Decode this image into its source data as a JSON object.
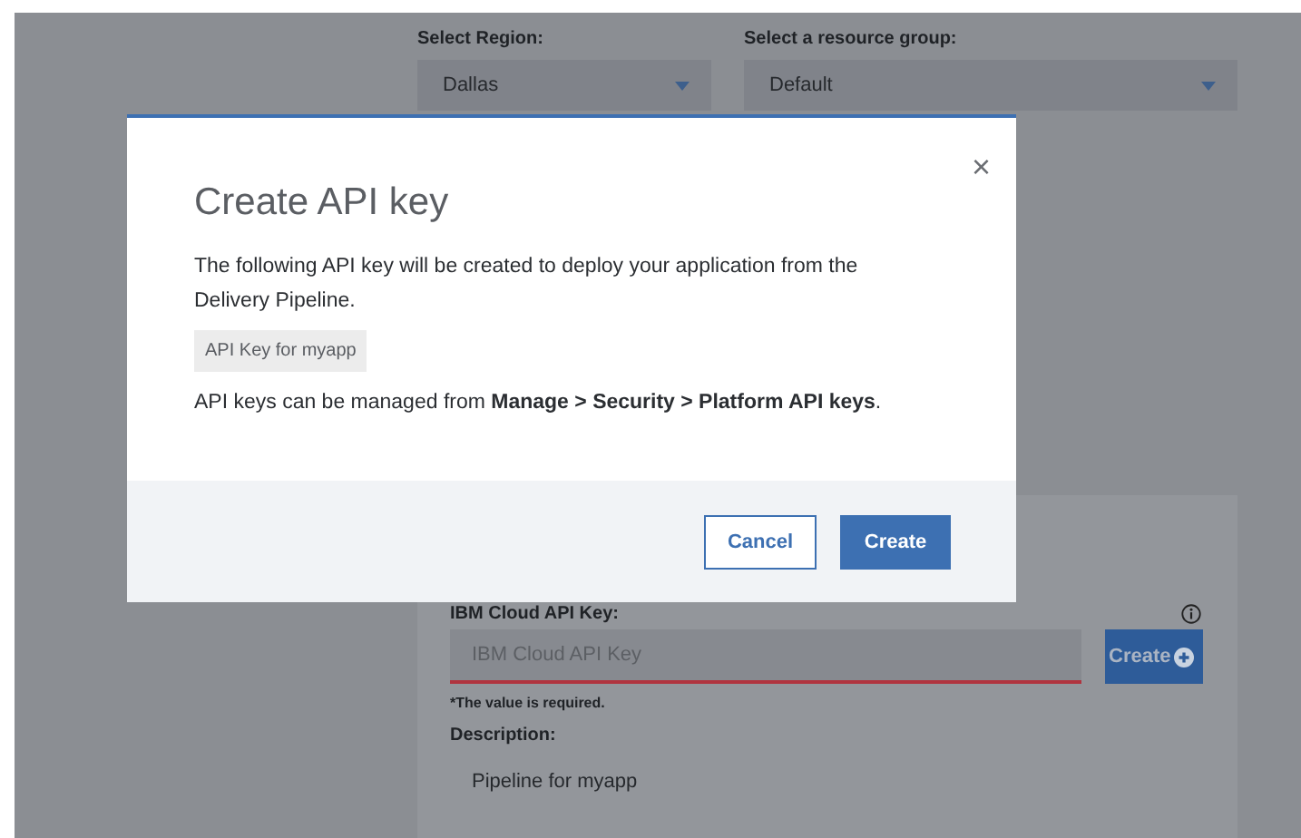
{
  "region": {
    "label": "Select Region:",
    "value": "Dallas"
  },
  "resource_group": {
    "label": "Select a resource group:",
    "value": "Default"
  },
  "api_key_field": {
    "label": "IBM Cloud API Key:",
    "placeholder": "IBM Cloud API Key",
    "error": "*The value is required.",
    "button": "Create"
  },
  "description": {
    "label": "Description:",
    "value": "Pipeline for myapp"
  },
  "dialog": {
    "title": "Create API key",
    "close": "×",
    "text": "The following API key will be created to deploy your application from the Delivery Pipeline.",
    "key_name": "API Key for myapp",
    "note": "API keys can be managed from **Manage > Security > Platform API keys**.",
    "buttons": [
      {
        "label": "Cancel",
        "kind": "secondary"
      },
      {
        "label": "Create",
        "kind": "primary"
      }
    ]
  }
}
